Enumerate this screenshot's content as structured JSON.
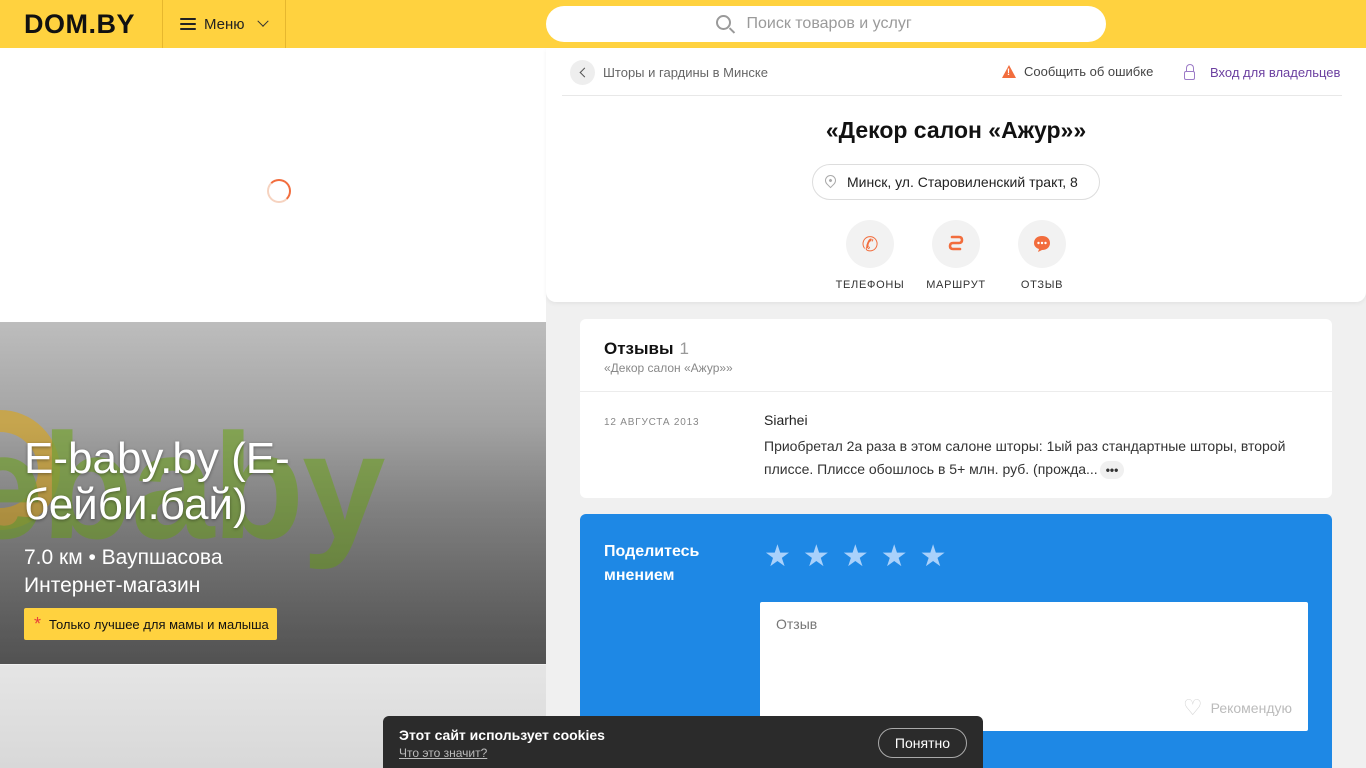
{
  "header": {
    "logo": "DOM.BY",
    "menu_label": "Меню",
    "search_placeholder": "Поиск товаров и услуг"
  },
  "promo": {
    "title": "E-baby.by (E-бейби.бай)",
    "meta": "7.0 км • Ваупшасова",
    "category": "Интернет-магазин",
    "badge": "Только лучшее для мамы и малыша",
    "bg_text": "ebaby"
  },
  "company": {
    "breadcrumb": "Шторы и гардины в Минске",
    "report_error": "Сообщить об ошибке",
    "owner_login": "Вход для владельцев",
    "title": "«Декор салон «Ажур»»",
    "address": "Минск, ул. Старовиленский тракт, 8",
    "actions": [
      {
        "label": "ТЕЛЕФОНЫ",
        "icon": "phone-icon"
      },
      {
        "label": "МАРШРУТ",
        "icon": "route-icon"
      },
      {
        "label": "ОТЗЫВ",
        "icon": "comment-icon"
      }
    ]
  },
  "reviews": {
    "heading": "Отзывы",
    "count": "1",
    "subtitle": "«Декор салон «Ажур»»",
    "items": [
      {
        "date": "12 АВГУСТА 2013",
        "author": "Siarhei",
        "text": "Приобретал 2а раза в этом салоне шторы: 1ый раз стандартные шторы, второй плиссе. Плиссе обошлось в 5+ млн. руб. (прожда..."
      }
    ]
  },
  "opinion": {
    "title": "Поделитесь мнением",
    "review_placeholder": "Отзыв",
    "recommend_label": "Рекомендую",
    "star_count": 5
  },
  "cookie": {
    "title": "Этот сайт использует cookies",
    "link": "Что это значит?",
    "button": "Понятно"
  },
  "colors": {
    "accent_yellow": "#ffd23f",
    "accent_orange": "#f26d3d",
    "form_blue": "#1e88e5",
    "link_purple": "#6b3fa0"
  }
}
